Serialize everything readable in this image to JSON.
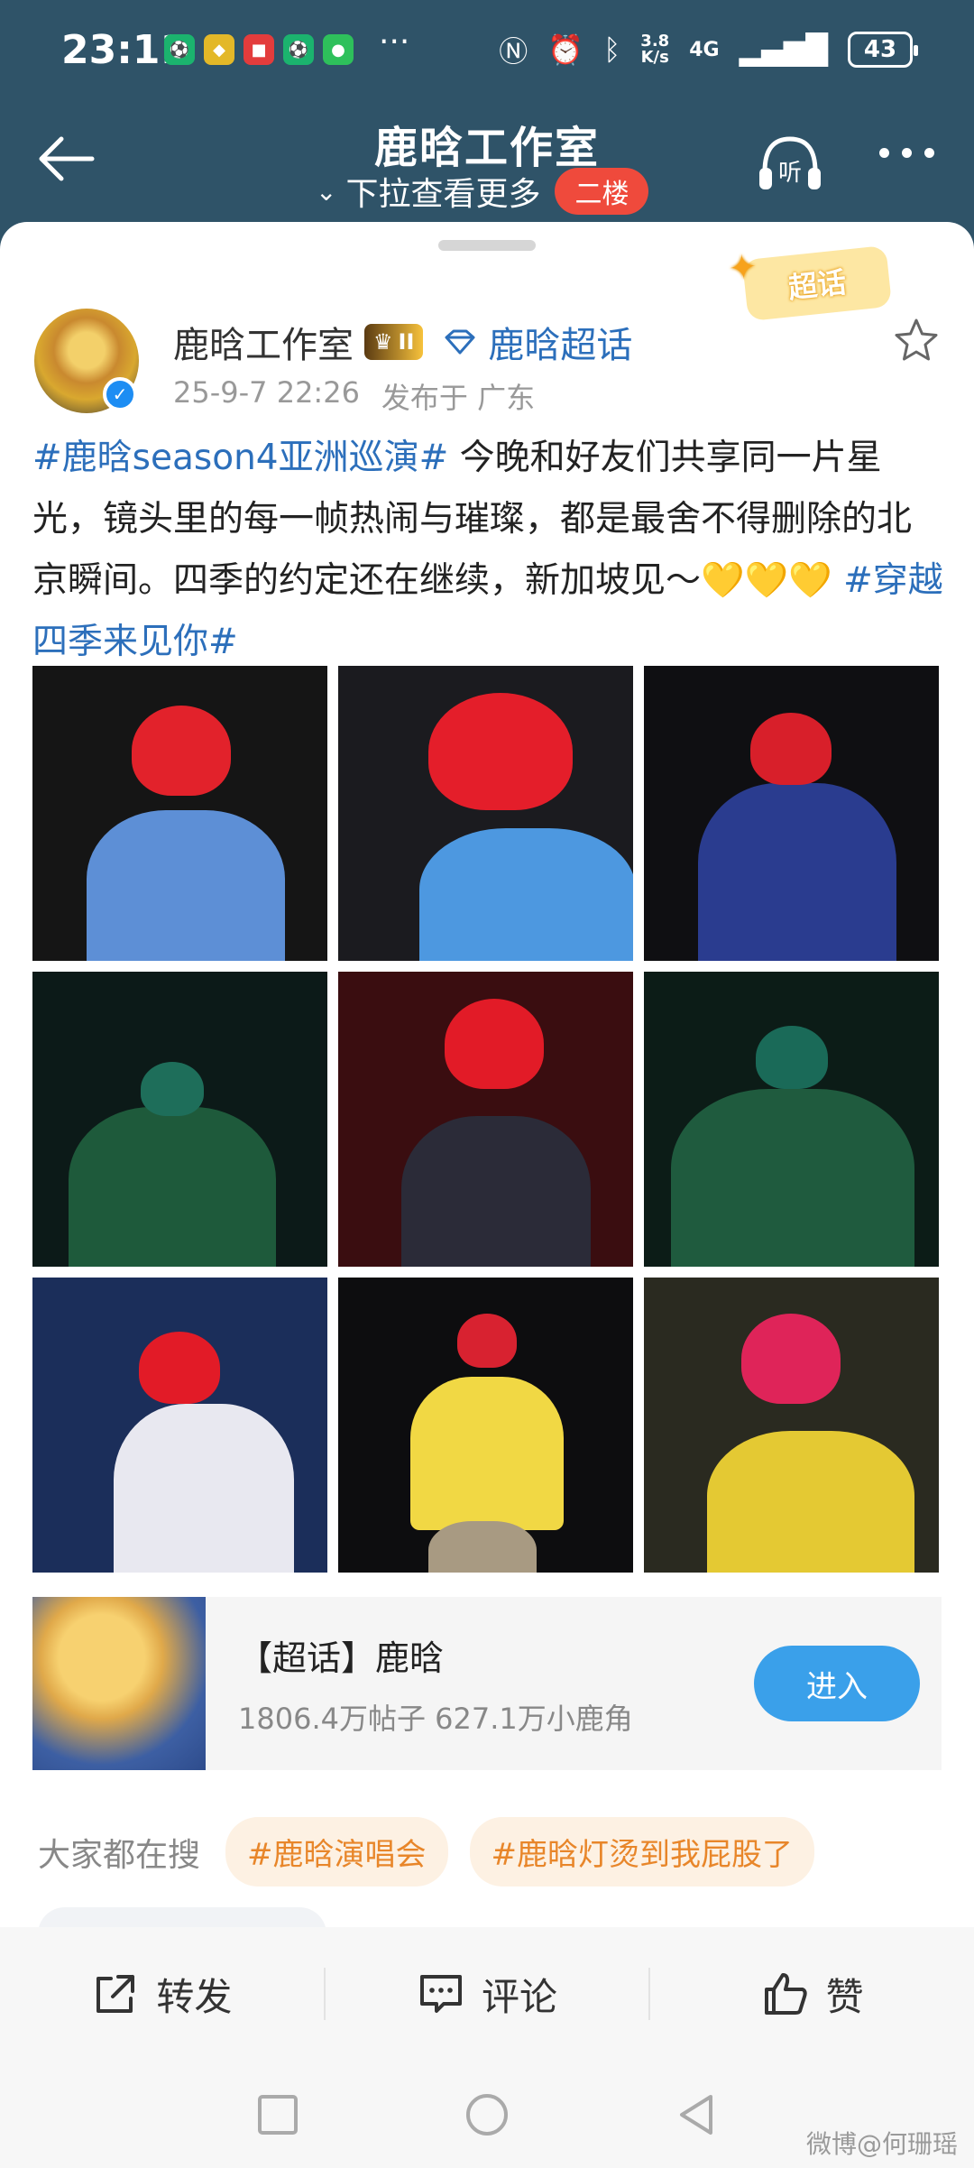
{
  "status_bar": {
    "time": "23:11",
    "more": "···",
    "net_speed_top": "3.8",
    "net_speed_bottom": "K/s",
    "net_type": "4G",
    "battery": "43"
  },
  "header": {
    "title": "鹿晗工作室",
    "subtitle": "下拉查看更多",
    "floor_badge": "二楼",
    "listen_label": "听"
  },
  "post": {
    "sticker": "超话",
    "author": "鹿晗工作室",
    "level": "II",
    "topic": "鹿晗超话",
    "date": "25-9-7 22:26",
    "location": "发布于 广东",
    "text": {
      "hashtag1": "#鹿晗season4亚洲巡演#",
      "body": " 今晚和好友们共享同一片星光，镜头里的每一帧热闹与璀璨，都是最舍不得删除的北京瞬间。四季的约定还在继续，新加坡见～",
      "hearts": "💛💛💛",
      "hashtag2": " #穿越四季来见你#"
    }
  },
  "super_topic": {
    "title": "【超话】鹿晗",
    "stats": "1806.4万帖子 627.1万小鹿角",
    "enter": "进入"
  },
  "trending": {
    "label": "大家都在搜",
    "chips": [
      "#鹿晗演唱会",
      "#鹿晗灯烫到我屁股了"
    ]
  },
  "actions": {
    "repost": "转发",
    "comment": "评论",
    "like": "赞"
  },
  "watermark": "微博@何珊瑶"
}
